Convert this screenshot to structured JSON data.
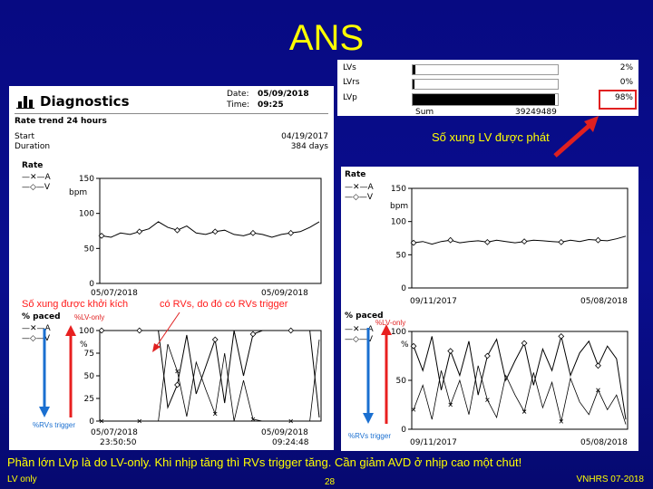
{
  "slide": {
    "title": "ANS",
    "footer_left": "LV only",
    "footer_center": "28",
    "footer_right": "VNHRS 07-2018",
    "bottom_note": "Phần lớn LVp là do LV-only. Khi nhịp tăng thì RVs trigger tăng. Cần giảm AVD ở nhịp cao một chút!"
  },
  "pacing_box": {
    "rows": [
      {
        "label": "LVs",
        "pct": "2%",
        "fill": 0.02
      },
      {
        "label": "LVrs",
        "pct": "0%",
        "fill": 0.005
      },
      {
        "label": "LVp",
        "pct": "98%",
        "fill": 0.98
      }
    ],
    "sum_label": "Sum",
    "sum_value": "39249489",
    "callout": "Số xung LV được phát"
  },
  "diagnostics": {
    "title": "Diagnostics",
    "date_label": "Date:",
    "date_value": "05/09/2018",
    "time_label": "Time:",
    "time_value": "09:25",
    "subtitle": "Rate trend 24 hours",
    "start_label": "Start",
    "start_value": "04/19/2017",
    "duration_label": "Duration",
    "duration_value": "384 days"
  },
  "left_rate": {
    "title": "Rate",
    "legend_a": "A",
    "legend_v": "V",
    "unit": "bpm",
    "x_start": "05/07/2018",
    "x_end": "05/09/2018"
  },
  "left_paced": {
    "title": "% paced",
    "legend_a": "A",
    "legend_v": "V",
    "unit": "%",
    "x_start": "05/07/2018",
    "x_start_time": "23:50:50",
    "x_end": "05/09/2018",
    "x_end_time": "09:24:48",
    "note_left": "Số xung được khởi kích",
    "note_right": "có RVs, do đó có RVs trigger",
    "lv_only": "%LV-only",
    "rvs_trigger": "%RVs trigger"
  },
  "right_rate": {
    "title": "Rate",
    "legend_a": "A",
    "legend_v": "V",
    "unit": "bpm",
    "x_start": "09/11/2017",
    "x_end": "05/08/2018"
  },
  "right_paced": {
    "title": "% paced",
    "legend_a": "A",
    "legend_v": "V",
    "unit": "%",
    "x_start": "09/11/2017",
    "x_end": "05/08/2018",
    "lv_only": "%LV-only",
    "rvs_trigger": "%RVs trigger"
  },
  "chart_data": [
    {
      "type": "line",
      "title": "Rate",
      "ylabel": "bpm",
      "ylim": [
        0,
        150
      ],
      "ticks": [
        "150",
        "100",
        "50",
        "0"
      ],
      "x": [
        "05/07/2018",
        "05/09/2018"
      ],
      "series": [
        {
          "name": "V",
          "values": [
            68,
            66,
            72,
            70,
            74,
            78,
            88,
            80,
            76,
            82,
            72,
            70,
            74,
            76,
            70,
            68,
            72,
            70,
            66,
            70,
            72,
            74,
            80,
            88
          ]
        }
      ]
    },
    {
      "type": "line",
      "title": "% paced",
      "ylabel": "%",
      "ylim": [
        0,
        100
      ],
      "ticks": [
        "100",
        "75",
        "50",
        "25",
        "0"
      ],
      "x": [
        "05/07/2018 23:50:50",
        "05/09/2018 09:24:48"
      ],
      "series": [
        {
          "name": "V",
          "values": [
            100,
            100,
            100,
            100,
            100,
            100,
            100,
            15,
            40,
            95,
            30,
            60,
            90,
            20,
            100,
            50,
            96,
            100,
            100,
            100,
            100,
            100,
            100,
            4
          ]
        },
        {
          "name": "A",
          "values": [
            0,
            0,
            0,
            0,
            0,
            0,
            0,
            85,
            55,
            5,
            65,
            35,
            8,
            75,
            0,
            45,
            2,
            0,
            0,
            0,
            0,
            0,
            0,
            90
          ]
        }
      ]
    },
    {
      "type": "line",
      "title": "Rate",
      "ylabel": "bpm",
      "ylim": [
        0,
        150
      ],
      "ticks": [
        "150",
        "100",
        "50",
        "0"
      ],
      "x": [
        "09/11/2017",
        "05/08/2018"
      ],
      "series": [
        {
          "name": "V",
          "values": [
            68,
            70,
            66,
            70,
            72,
            68,
            70,
            71,
            69,
            72,
            70,
            68,
            70,
            72,
            71,
            70,
            69,
            72,
            70,
            73,
            72,
            71,
            74,
            78
          ]
        }
      ]
    },
    {
      "type": "line",
      "title": "% paced",
      "ylabel": "%",
      "ylim": [
        0,
        100
      ],
      "ticks": [
        "100",
        "50",
        "0"
      ],
      "x": [
        "09/11/2017",
        "05/08/2018"
      ],
      "series": [
        {
          "name": "V",
          "values": [
            85,
            60,
            95,
            40,
            80,
            55,
            90,
            35,
            75,
            92,
            50,
            70,
            88,
            45,
            82,
            60,
            95,
            55,
            78,
            90,
            65,
            85,
            72,
            10
          ]
        },
        {
          "name": "A",
          "values": [
            20,
            45,
            10,
            60,
            25,
            50,
            15,
            65,
            30,
            12,
            55,
            35,
            18,
            58,
            22,
            48,
            8,
            52,
            28,
            15,
            40,
            20,
            35,
            5
          ]
        }
      ]
    }
  ],
  "colors": {
    "background": "#0a0e8f",
    "title": "#ffff00",
    "note_red": "#ff1a1a",
    "lv_arrow": "#e82020",
    "rv_arrow": "#1a6fd0",
    "box_red": "#e02020"
  }
}
